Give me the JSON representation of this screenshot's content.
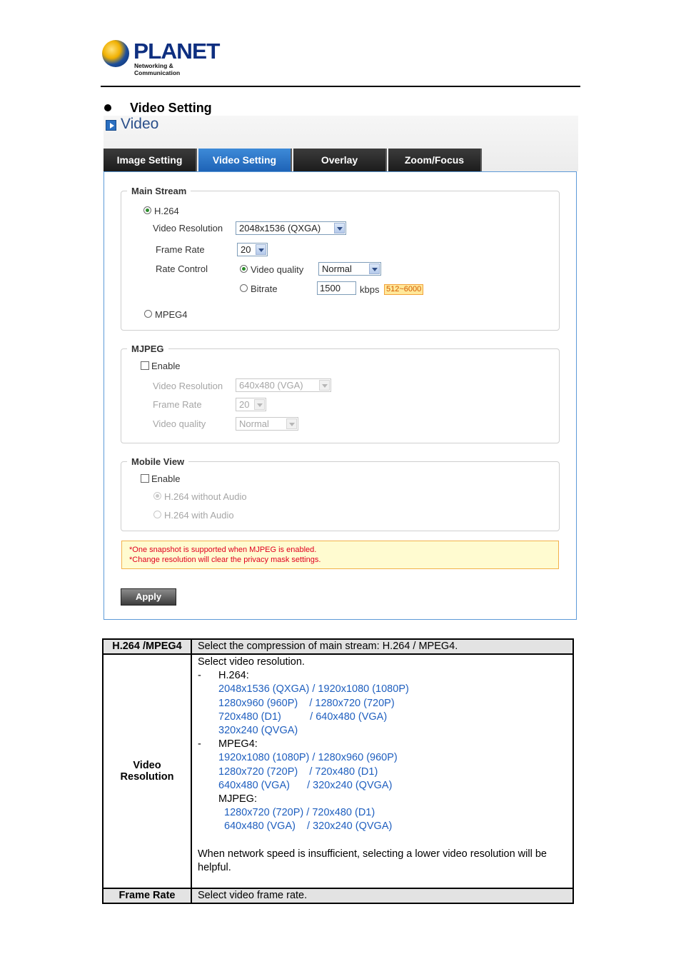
{
  "header": {
    "brand": "PLANET",
    "tagline": "Networking & Communication"
  },
  "section_title": "Video Setting",
  "panel": {
    "title": "Video",
    "tabs": [
      "Image Setting",
      "Video Setting",
      "Overlay",
      "Zoom/Focus"
    ],
    "active_tab": "Video Setting",
    "main_stream": {
      "legend": "Main Stream",
      "h264_label": "H.264",
      "h264_selected": true,
      "resolution_label": "Video Resolution",
      "resolution_value": "2048x1536 (QXGA)",
      "frame_rate_label": "Frame Rate",
      "frame_rate_value": "20",
      "rate_control_label": "Rate Control",
      "video_quality_label": "Video quality",
      "video_quality_selected": true,
      "quality_value": "Normal",
      "bitrate_label": "Bitrate",
      "bitrate_value": "1500",
      "bitrate_unit": "kbps",
      "bitrate_range": "512~6000",
      "mpeg4_label": "MPEG4"
    },
    "mjpeg": {
      "legend": "MJPEG",
      "enable_label": "Enable",
      "resolution_label": "Video Resolution",
      "resolution_value": "640x480 (VGA)",
      "frame_rate_label": "Frame Rate",
      "frame_rate_value": "20",
      "quality_label": "Video quality",
      "quality_value": "Normal"
    },
    "mobile_view": {
      "legend": "Mobile View",
      "enable_label": "Enable",
      "option1": "H.264 without Audio",
      "option2": "H.264 with Audio"
    },
    "notes": [
      "*One snapshot is supported when MJPEG is enabled.",
      "*Change resolution will clear the privacy mask settings."
    ],
    "apply_label": "Apply"
  },
  "table": {
    "row1_key": "H.264 /MPEG4",
    "row1_value": "Select the compression of main stream: H.264 / MPEG4.",
    "row2_key_line1": "Video",
    "row2_key_line2": "Resolution",
    "row2_intro": "Select video resolution.",
    "h264_label": "H.264:",
    "h264_lines": [
      "2048x1536 (QXGA) / 1920x1080 (1080P)",
      "1280x960 (960P)    / 1280x720 (720P)",
      "720x480 (D1)          / 640x480 (VGA)",
      "320x240 (QVGA)"
    ],
    "mpeg4_label": "MPEG4:",
    "mpeg4_lines": [
      "1920x1080 (1080P) / 1280x960 (960P)",
      "1280x720 (720P)    / 720x480 (D1)",
      "640x480 (VGA)      / 320x240 (QVGA)"
    ],
    "mjpeg_label": "MJPEG:",
    "mjpeg_lines": [
      "1280x720 (720P) / 720x480 (D1)",
      "640x480 (VGA)    / 320x240 (QVGA)"
    ],
    "row2_footer": "When network speed is insufficient, selecting a lower video resolution will be helpful.",
    "row3_key": "Frame Rate",
    "row3_value": "Select video frame rate."
  },
  "colors": {
    "tab_active": "#2d76c9",
    "link_blue": "#1f5fbf",
    "note_text": "#e0001e",
    "panel_border": "#5d9ad8"
  }
}
